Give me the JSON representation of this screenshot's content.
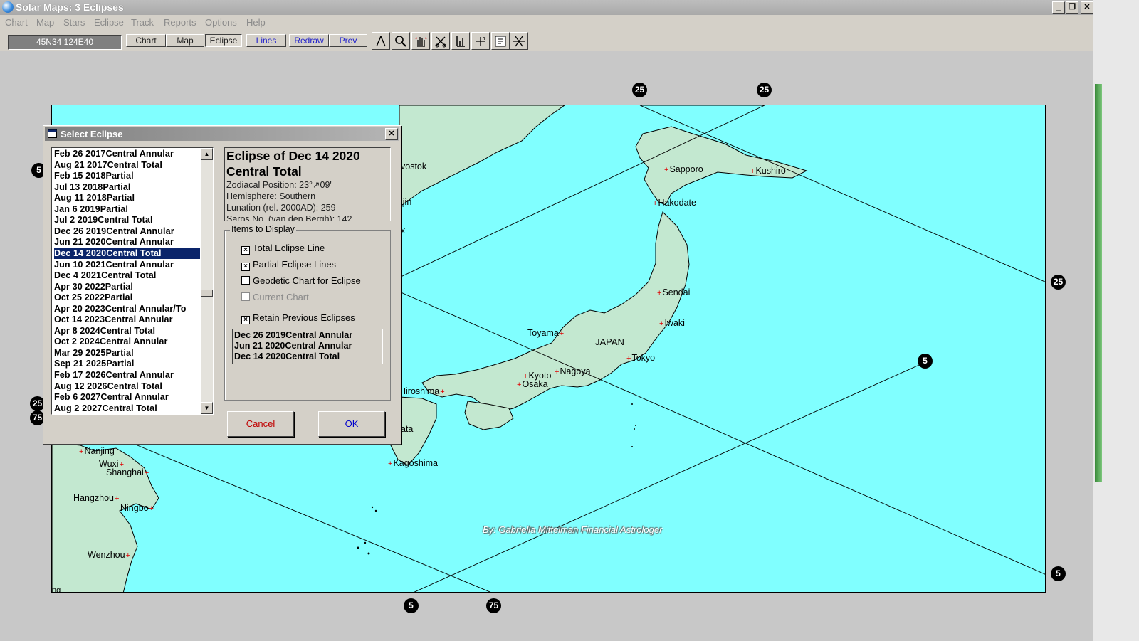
{
  "window": {
    "title": "Solar Maps: 3 Eclipses"
  },
  "menu": [
    "Chart",
    "Map",
    "Stars",
    "Eclipse",
    "Track",
    "Reports",
    "Options",
    "Help"
  ],
  "toolbar": {
    "coord": "45N34 124E40",
    "buttons": [
      {
        "label": "Chart",
        "color": "dark"
      },
      {
        "label": "Map",
        "color": "dark"
      },
      {
        "label": "Eclipse",
        "color": "dark"
      },
      {
        "label": "Lines",
        "color": "blue"
      },
      {
        "label": "Redraw",
        "color": "blue"
      },
      {
        "label": "Prev",
        "color": "blue"
      }
    ],
    "icons": [
      "compass-icon",
      "zoom-icon",
      "hand-icon",
      "scissors-icon",
      "ruler-icon",
      "crosshair-icon",
      "info-icon",
      "cross-lines-icon"
    ]
  },
  "map": {
    "country": "JAPAN",
    "byline": "By:  Gabriella Mittelman Financial Astrologer",
    "cities": [
      "Sapporo",
      "Kushiro",
      "Hakodate",
      "Sendai",
      "Iwaki",
      "Toyama",
      "Tokyo",
      "Nagoya",
      "Kyoto",
      "Osaka",
      "Hiroshima",
      "Kagoshima",
      "Nanjing",
      "Wuxi",
      "Shanghai",
      "Hangzhou",
      "Ningbo",
      "Wenzhou"
    ],
    "partial_labels": [
      "vostok",
      "ljin",
      "x",
      "ata",
      "ng"
    ],
    "line_labels": [
      "25",
      "25",
      "25",
      "5",
      "5",
      "5",
      "75",
      "5",
      "25",
      "75"
    ]
  },
  "dialog": {
    "title": "Select Eclipse",
    "eclipses": [
      "Feb 26 2017Central Annular",
      "Aug 21 2017Central Total",
      "Feb 15 2018Partial",
      "Jul 13 2018Partial",
      "Aug 11 2018Partial",
      "Jan 6 2019Partial",
      "Jul 2 2019Central Total",
      "Dec 26 2019Central Annular",
      "Jun 21 2020Central Annular",
      "Dec 14 2020Central Total",
      "Jun 10 2021Central Annular",
      "Dec 4 2021Central Total",
      "Apr 30 2022Partial",
      "Oct 25 2022Partial",
      "Apr 20 2023Central Annular/To",
      "Oct 14 2023Central Annular",
      "Apr 8 2024Central Total",
      "Oct 2 2024Central Annular",
      "Mar 29 2025Partial",
      "Sep 21 2025Partial",
      "Feb 17 2026Central Annular",
      "Aug 12 2026Central Total",
      "Feb 6 2027Central Annular",
      "Aug 2 2027Central Total"
    ],
    "selected": "Dec 14 2020Central Total",
    "info": {
      "title_line1": "Eclipse of Dec 14 2020",
      "title_line2": "Central Total",
      "zodiacal": "Zodiacal Position: 23°↗09'",
      "hemisphere": "Hemisphere: Southern",
      "lunation": "Lunation (rel. 2000AD): 259",
      "saros": "Saros No. (van den Bergh): 142"
    },
    "group_label": "Items to Display",
    "options": [
      {
        "label": "Total Eclipse Line",
        "checked": true,
        "enabled": true
      },
      {
        "label": "Partial Eclipse Lines",
        "checked": true,
        "enabled": true
      },
      {
        "label": "Geodetic Chart for Eclipse",
        "checked": false,
        "enabled": true
      },
      {
        "label": "Current Chart",
        "checked": false,
        "enabled": false
      },
      {
        "label": "Retain Previous Eclipses",
        "checked": true,
        "enabled": true
      }
    ],
    "previous": [
      "Dec 26 2019Central Annular",
      "Jun 21 2020Central Annular",
      "Dec 14 2020Central Total"
    ],
    "cancel": "Cancel",
    "ok": "OK"
  },
  "colors": {
    "sea": "#80ffff",
    "land": "#c3e8d0",
    "selection": "#0a246a",
    "city_marker": "#e00000"
  }
}
